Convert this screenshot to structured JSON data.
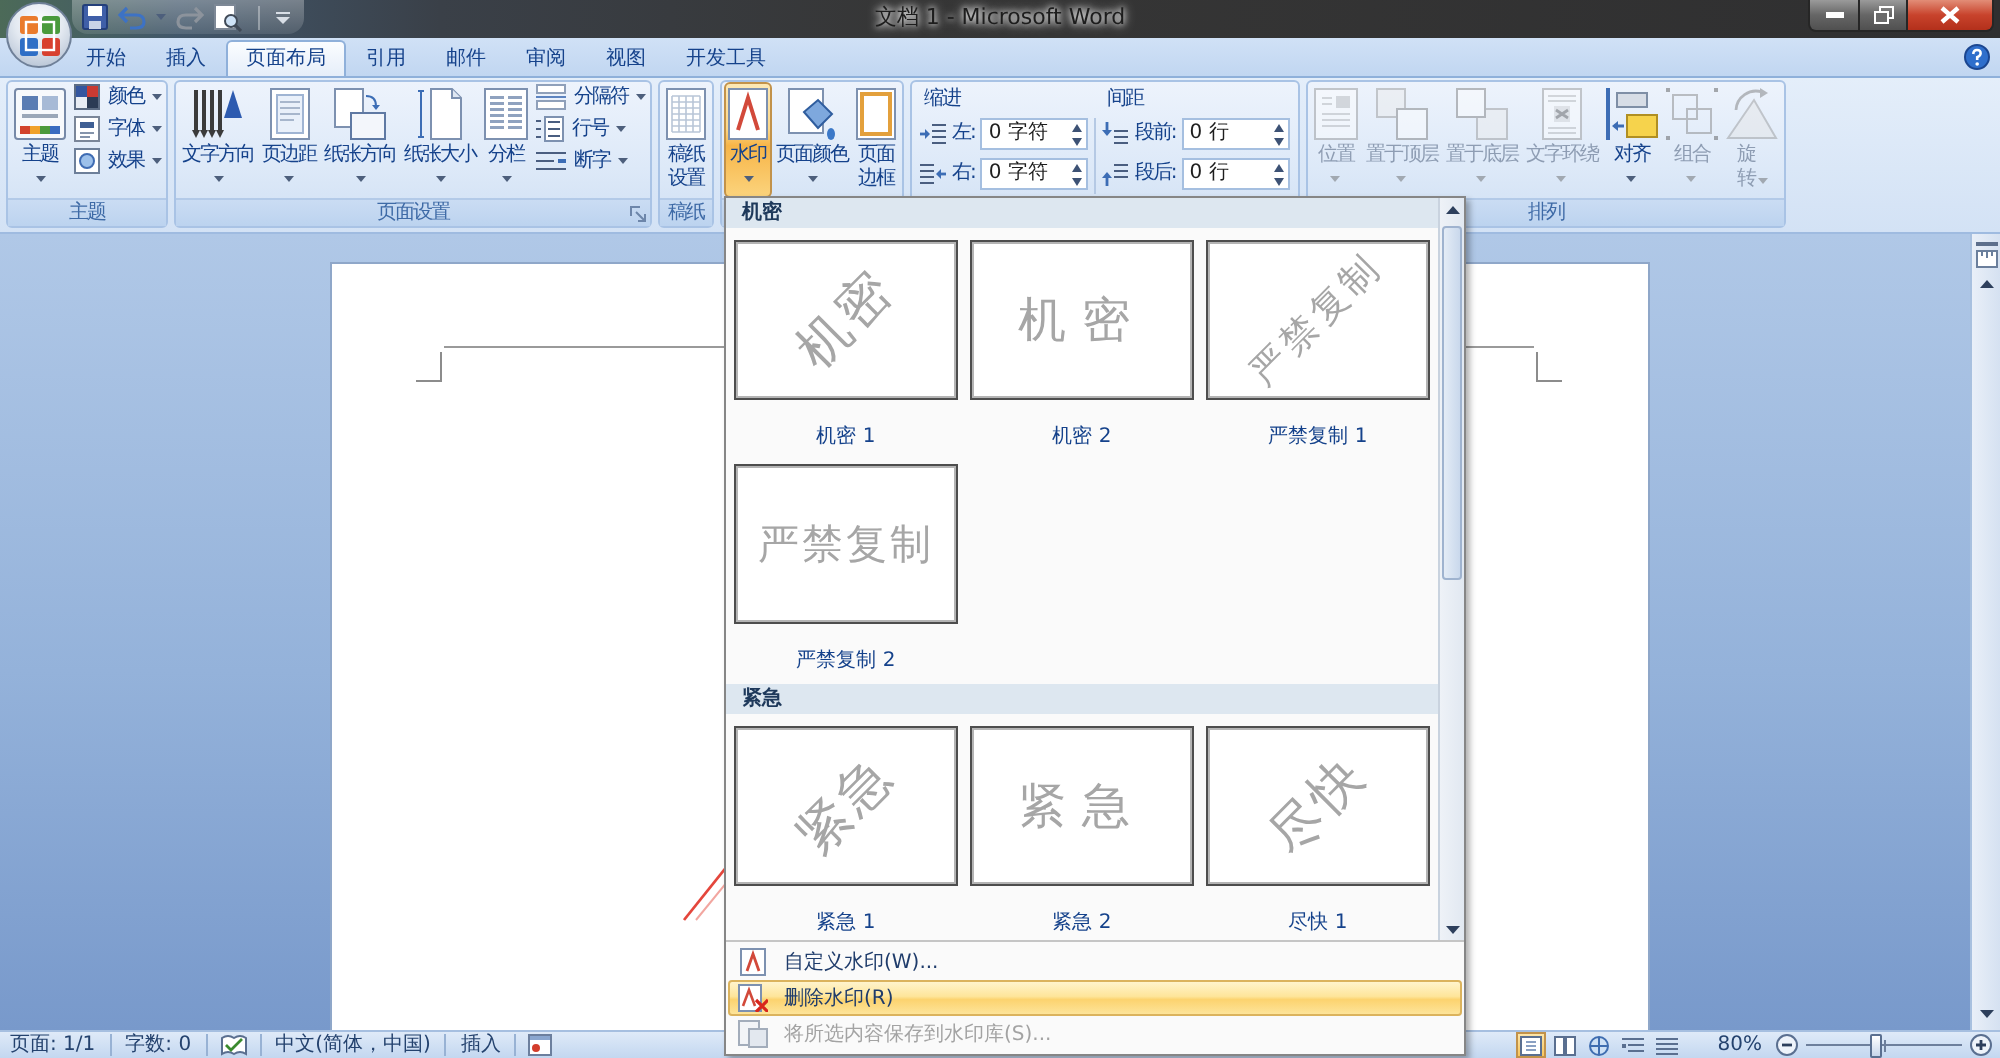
{
  "window": {
    "title": "文档 1 - Microsoft Word"
  },
  "tabs": [
    {
      "label": "开始",
      "selected": false
    },
    {
      "label": "插入",
      "selected": false
    },
    {
      "label": "页面布局",
      "selected": true
    },
    {
      "label": "引用",
      "selected": false
    },
    {
      "label": "邮件",
      "selected": false
    },
    {
      "label": "审阅",
      "selected": false
    },
    {
      "label": "视图",
      "selected": false
    },
    {
      "label": "开发工具",
      "selected": false
    }
  ],
  "ribbon": {
    "groups": [
      {
        "kind": "buttons",
        "label": "主题",
        "items": [
          {
            "kind": "large",
            "label": "主题",
            "dropdown": true
          },
          {
            "kind": "small",
            "label": "颜色",
            "dropdown": true
          },
          {
            "kind": "small",
            "label": "字体",
            "dropdown": true
          },
          {
            "kind": "small",
            "label": "效果",
            "dropdown": true
          }
        ]
      },
      {
        "kind": "buttons",
        "label": "页面设置",
        "launcher": true,
        "items": [
          {
            "kind": "large",
            "label": "文字方向",
            "dropdown": true
          },
          {
            "kind": "large",
            "label": "页边距",
            "dropdown": true
          },
          {
            "kind": "large",
            "label": "纸张方向",
            "dropdown": true
          },
          {
            "kind": "large",
            "label": "纸张大小",
            "dropdown": true
          },
          {
            "kind": "large",
            "label": "分栏",
            "dropdown": true
          },
          {
            "kind": "small",
            "label": "分隔符",
            "dropdown": true
          },
          {
            "kind": "small",
            "label": "行号",
            "dropdown": true
          },
          {
            "kind": "small",
            "label": "断字",
            "dropdown": true
          }
        ]
      },
      {
        "kind": "buttons",
        "label": "稿纸",
        "items": [
          {
            "kind": "stacked",
            "label": "稿纸设置",
            "dropdown": false
          }
        ]
      },
      {
        "kind": "buttons",
        "items": [
          {
            "kind": "large",
            "label": "水印",
            "dropdown": true,
            "pressed": true,
            "menu": {
              "sections": [
                {
                  "heading": "机密",
                  "items": [
                    {
                      "label": "机密 1",
                      "watermark": "机密",
                      "kind": "diagonal"
                    },
                    {
                      "label": "机密 2",
                      "watermark": "机密",
                      "kind": "horizontal"
                    },
                    {
                      "label": "严禁复制 1",
                      "watermark": "严禁复制",
                      "kind": "diagonal"
                    },
                    {
                      "label": "严禁复制 2",
                      "watermark": "严禁复制",
                      "kind": "horizontal"
                    }
                  ]
                },
                {
                  "heading": "紧急",
                  "items": [
                    {
                      "label": "紧急 1",
                      "watermark": "紧急",
                      "kind": "diagonal"
                    },
                    {
                      "label": "紧急 2",
                      "watermark": "紧急",
                      "kind": "horizontal"
                    },
                    {
                      "label": "尽快 1",
                      "watermark": "尽快",
                      "kind": "diagonal"
                    }
                  ]
                }
              ],
              "commands": [
                {
                  "label": "自定义水印(W)...",
                  "highlighted": false,
                  "disabled": false
                },
                {
                  "label": "删除水印(R)",
                  "highlighted": true,
                  "disabled": false
                },
                {
                  "label": "将所选内容保存到水印库(S)...",
                  "highlighted": false,
                  "disabled": true
                }
              ]
            }
          },
          {
            "kind": "large",
            "label": "页面颜色",
            "dropdown": true,
            "pressed": false
          },
          {
            "kind": "stacked",
            "label": "页面边框",
            "dropdown": false,
            "pressed": false
          }
        ]
      },
      {
        "kind": "fields",
        "sections": [
          {
            "heading": "缩进",
            "fields": [
              {
                "label": "左:",
                "value": "0 字符"
              },
              {
                "label": "右:",
                "value": "0 字符"
              }
            ]
          },
          {
            "heading": "间距",
            "fields": [
              {
                "label": "段前:",
                "value": "0 行"
              },
              {
                "label": "段后:",
                "value": "0 行"
              }
            ]
          }
        ]
      },
      {
        "kind": "buttons",
        "label": "排列",
        "items": [
          {
            "kind": "large",
            "label": "位置",
            "dropdown": true,
            "disabled": true
          },
          {
            "kind": "large",
            "label": "置于顶层",
            "dropdown": true,
            "disabled": true
          },
          {
            "kind": "large",
            "label": "置于底层",
            "dropdown": true,
            "disabled": true
          },
          {
            "kind": "large",
            "label": "文字环绕",
            "dropdown": true,
            "disabled": true
          },
          {
            "kind": "large",
            "label": "对齐",
            "dropdown": true,
            "disabled": false
          },
          {
            "kind": "large",
            "label": "组合",
            "dropdown": true,
            "disabled": true
          },
          {
            "kind": "stacked",
            "label": "旋转",
            "dropdown": true,
            "disabled": true
          }
        ]
      }
    ]
  },
  "status_bar": {
    "page": "页面: 1/1",
    "words": "字数: 0",
    "language": "中文(简体，中国)",
    "mode": "插入",
    "views": [
      {
        "selected": true
      },
      {
        "selected": false
      },
      {
        "selected": false
      },
      {
        "selected": false
      },
      {
        "selected": false
      }
    ],
    "zoom": {
      "reading": "80%",
      "level": 0.45
    }
  }
}
